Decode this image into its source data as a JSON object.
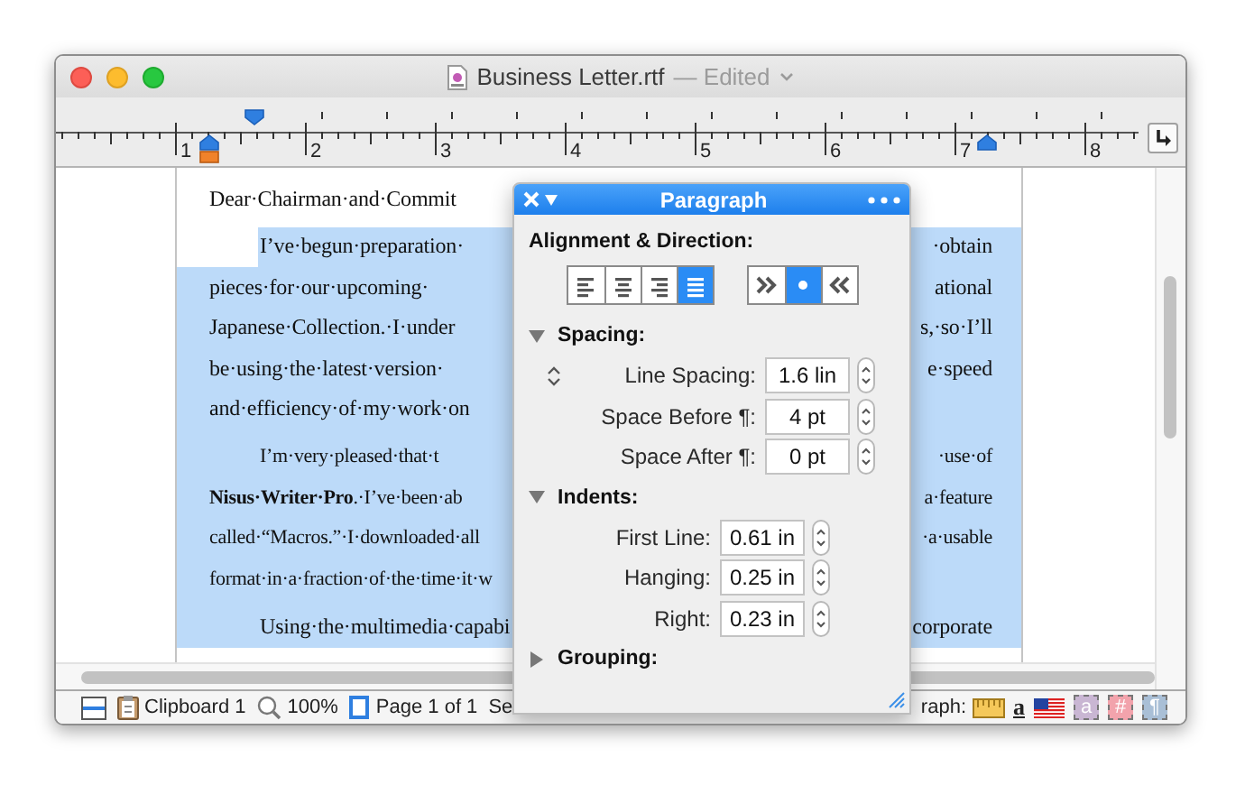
{
  "window": {
    "title": "Business Letter.rtf",
    "status": "— Edited"
  },
  "ruler": {
    "labels": [
      "1",
      "2",
      "3",
      "4",
      "5",
      "6",
      "7",
      "8"
    ]
  },
  "document": {
    "paragraphs": [
      {
        "kind": "greeting",
        "selected": false,
        "lines": [
          {
            "left": "Dear·Chairman·and·Commit"
          }
        ]
      },
      {
        "kind": "body",
        "selected": true,
        "lines": [
          {
            "left": "I’ve·begun·preparation·",
            "right": "·obtain"
          },
          {
            "left": "pieces·for·our·upcoming·",
            "right": "ational"
          },
          {
            "left": "Japanese·Collection.·I·under",
            "right": "s,·so·I’ll"
          },
          {
            "left": "be·using·the·latest·version·",
            "right": "e·speed"
          },
          {
            "left": "and·efficiency·of·my·work·on"
          }
        ]
      },
      {
        "kind": "compact",
        "selected": true,
        "lines": [
          {
            "left": "I’m·very·pleased·that·t",
            "right": "·use·of"
          },
          {
            "left": "**Nisus·Writer·Pro**.·I’ve·been·ab",
            "right": "a·feature"
          },
          {
            "left": "called·“Macros.”·I·downloaded·all",
            "right": "·a·usable"
          },
          {
            "left": "format·in·a·fraction·of·the·time·it·w"
          }
        ]
      },
      {
        "kind": "body",
        "selected": true,
        "lines": [
          {
            "left": "Using·the·multimedia·capabi",
            "right": "corporate"
          }
        ]
      }
    ]
  },
  "palette": {
    "title": "Paragraph",
    "alignment_heading": "Alignment & Direction:",
    "alignment": [
      {
        "kind": "left",
        "selected": false
      },
      {
        "kind": "center",
        "selected": false
      },
      {
        "kind": "right",
        "selected": false
      },
      {
        "kind": "justify",
        "selected": true
      }
    ],
    "direction": [
      {
        "kind": "ltr",
        "selected": false
      },
      {
        "kind": "natural",
        "selected": true
      },
      {
        "kind": "rtl",
        "selected": false
      }
    ],
    "sections": [
      {
        "title": "Spacing:",
        "expanded": true,
        "kind": "spacing",
        "rows": [
          {
            "label": "Line Spacing:",
            "value": "1.6 lin",
            "mode_icon": true
          },
          {
            "label": "Space Before ¶:",
            "value": "4 pt",
            "mode_icon": false
          },
          {
            "label": "Space After ¶:",
            "value": "0 pt",
            "mode_icon": false
          }
        ]
      },
      {
        "title": "Indents:",
        "expanded": true,
        "kind": "indents",
        "rows": [
          {
            "label": "First Line:",
            "value": "0.61 in"
          },
          {
            "label": "Hanging:",
            "value": "0.25 in"
          },
          {
            "label": "Right:",
            "value": "0.23 in"
          }
        ]
      },
      {
        "title": "Grouping:",
        "expanded": false,
        "kind": "grouping"
      }
    ]
  },
  "status_bar": {
    "left": [
      {
        "kind": "split"
      },
      {
        "kind": "clipboard",
        "label": "Clipboard 1"
      },
      {
        "kind": "zoom",
        "label": "100%"
      },
      {
        "kind": "page",
        "label": "Page 1 of 1"
      },
      {
        "kind": "text",
        "label": "Se"
      }
    ],
    "right": [
      {
        "kind": "text",
        "label": "raph:"
      },
      {
        "kind": "ruler"
      },
      {
        "kind": "glyph",
        "label": "a"
      },
      {
        "kind": "flag"
      },
      {
        "kind": "tile",
        "label": "a",
        "color": "#c9b6d3"
      },
      {
        "kind": "tile",
        "label": "#",
        "color": "#f2a3ac"
      },
      {
        "kind": "tile",
        "label": "¶",
        "color": "#a9bfd6"
      }
    ]
  }
}
